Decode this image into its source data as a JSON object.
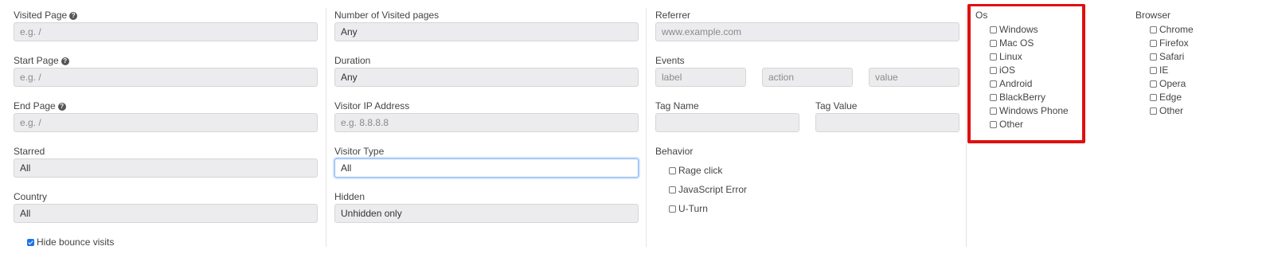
{
  "col1": {
    "visited_page": {
      "label": "Visited Page",
      "placeholder": "e.g. /"
    },
    "start_page": {
      "label": "Start Page",
      "placeholder": "e.g. /"
    },
    "end_page": {
      "label": "End Page",
      "placeholder": "e.g. /"
    },
    "starred": {
      "label": "Starred",
      "value": "All"
    },
    "country": {
      "label": "Country",
      "value": "All"
    },
    "hide_bounce": {
      "label": "Hide bounce visits",
      "checked": true
    }
  },
  "col2": {
    "num_visited": {
      "label": "Number of Visited pages",
      "value": "Any"
    },
    "duration": {
      "label": "Duration",
      "value": "Any"
    },
    "visitor_ip": {
      "label": "Visitor IP Address",
      "placeholder": "e.g. 8.8.8.8"
    },
    "visitor_type": {
      "label": "Visitor Type",
      "value": "All"
    },
    "hidden": {
      "label": "Hidden",
      "value": "Unhidden only"
    }
  },
  "col3": {
    "referrer": {
      "label": "Referrer",
      "placeholder": "www.example.com"
    },
    "events": {
      "label": "Events",
      "label_placeholder": "label",
      "action_placeholder": "action",
      "value_placeholder": "value"
    },
    "tag_name": {
      "label": "Tag Name"
    },
    "tag_value": {
      "label": "Tag Value"
    },
    "behavior": {
      "label": "Behavior",
      "options": [
        "Rage click",
        "JavaScript Error",
        "U-Turn"
      ]
    }
  },
  "os": {
    "label": "Os",
    "options": [
      "Windows",
      "Mac OS",
      "Linux",
      "iOS",
      "Android",
      "BlackBerry",
      "Windows Phone",
      "Other"
    ]
  },
  "browser": {
    "label": "Browser",
    "options": [
      "Chrome",
      "Firefox",
      "Safari",
      "IE",
      "Opera",
      "Edge",
      "Other"
    ]
  },
  "help_icon_glyph": "?",
  "colors": {
    "highlight_box": "#e01010",
    "focus_border": "#86b7ee",
    "checkbox_checked": "#1a73e8"
  }
}
